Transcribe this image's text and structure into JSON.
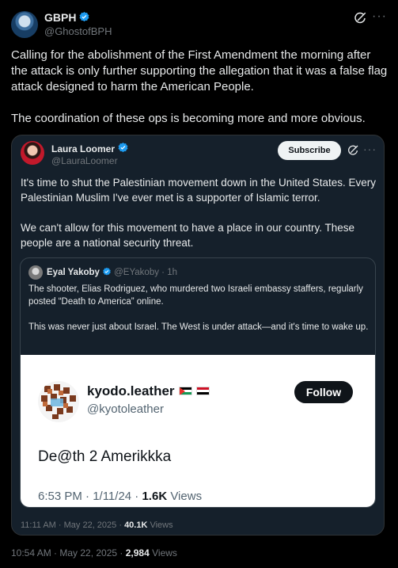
{
  "post": {
    "author": "GBPH",
    "handle": "@GhostofBPH",
    "text": "Calling for the abolishment of the First Amendment the morning after the attack is only further supporting the allegation that it was a false flag attack designed to harm the American People.\n\nThe coordination of these ops is becoming more and more obvious.",
    "time": "10:54 AM · May 22, 2025 · ",
    "views_count": "2,984",
    "views_label": " Views",
    "icons": [
      "verified-badge",
      "grok-icon",
      "more-icon"
    ]
  },
  "quote": {
    "author": "Laura Loomer",
    "handle": "@LauraLoomer",
    "subscribe_label": "Subscribe",
    "text": "It's time to shut the Palestinian movement down in the United States. Every Palestinian Muslim I've ever met is a supporter of Islamic terror.\n\nWe can't allow for this movement to have a place in our country. These people are a national security threat.",
    "time": "11:11 AM · May 22, 2025 · ",
    "views_count": "40.1K",
    "views_label": " Views"
  },
  "nested": {
    "author": "Eyal Yakoby",
    "handle": "@EYakoby",
    "age": " · 1h",
    "text": "The shooter, Elias Rodriguez, who murdered two Israeli embassy staffers, regularly posted “Death to America” online.\n\nThis was never just about Israel. The West is under attack—and it's time to wake up.",
    "image": {
      "name": "kyodo.leather",
      "handle": "@kyotoleather",
      "follow_label": "Follow",
      "text": "De@th 2 Amerikkka",
      "time": "6:53 PM · 1/11/24 · ",
      "views_count": "1.6K",
      "views_label": " Views"
    }
  },
  "colors": {
    "background": "#000000",
    "quote_background": "#15202b",
    "verified": "#1d9bf0",
    "muted": "#71767b"
  }
}
